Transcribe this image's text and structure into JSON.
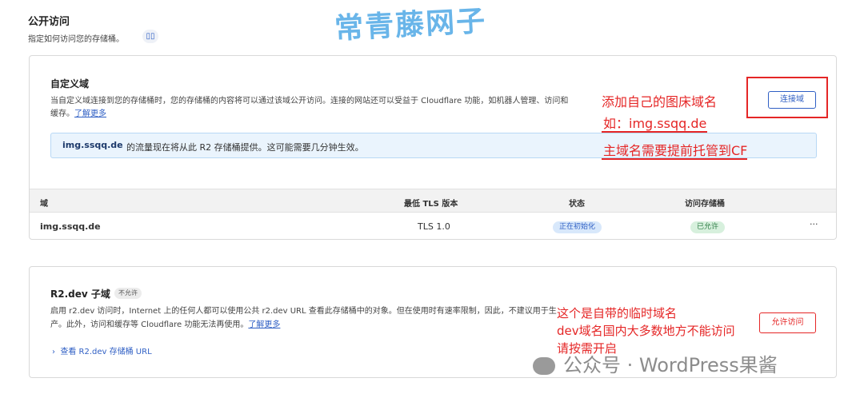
{
  "section": {
    "title": "公开访问",
    "subtitle": "指定如何访问您的存储桶。",
    "doc_icon_glyph": "▯▯"
  },
  "watermark_top": "常青藤网子",
  "custom_domain": {
    "title": "自定义域",
    "description": "当自定义域连接到您的存储桶时，您的存储桶的内容将可以通过该域公开访问。连接的网站还可以受益于 Cloudflare 功能，如机器人管理、访问和缓存。",
    "learn_more": "了解更多",
    "banner_domain": "img.ssqq.de",
    "banner_message": "的流量现在将从此 R2 存储桶提供。这可能需要几分钟生效。",
    "connect_button": "连接域",
    "table": {
      "headers": [
        "域",
        "最低 TLS 版本",
        "状态",
        "访问存储桶"
      ],
      "rows": [
        {
          "domain": "img.ssqq.de",
          "tls": "TLS 1.0",
          "status": "正在初始化",
          "access": "已允许",
          "more": "···"
        }
      ]
    }
  },
  "annotations": {
    "note1": "添加自己的图床域名",
    "note2": "如：img.ssqq.de",
    "note3": "主域名需要提前托管到CF",
    "note4": "这个是自带的临时域名",
    "note5": "dev域名国内大多数地方不能访问",
    "note6": "请按需开启",
    "color": "#e52626"
  },
  "r2_dev": {
    "title": "R2.dev 子域",
    "badge": "不允许",
    "description": "启用 r2.dev 访问时，Internet 上的任何人都可以使用公共 r2.dev URL 查看此存储桶中的对象。但在使用时有速率限制，因此，不建议用于生产。此外，访问和缓存等 Cloudflare 功能无法再使用。",
    "learn_more": "了解更多",
    "view_url_link": "查看 R2.dev 存储桶 URL",
    "allow_button": "允许访问"
  },
  "watermark_bottom": "公众号 · WordPress果酱"
}
